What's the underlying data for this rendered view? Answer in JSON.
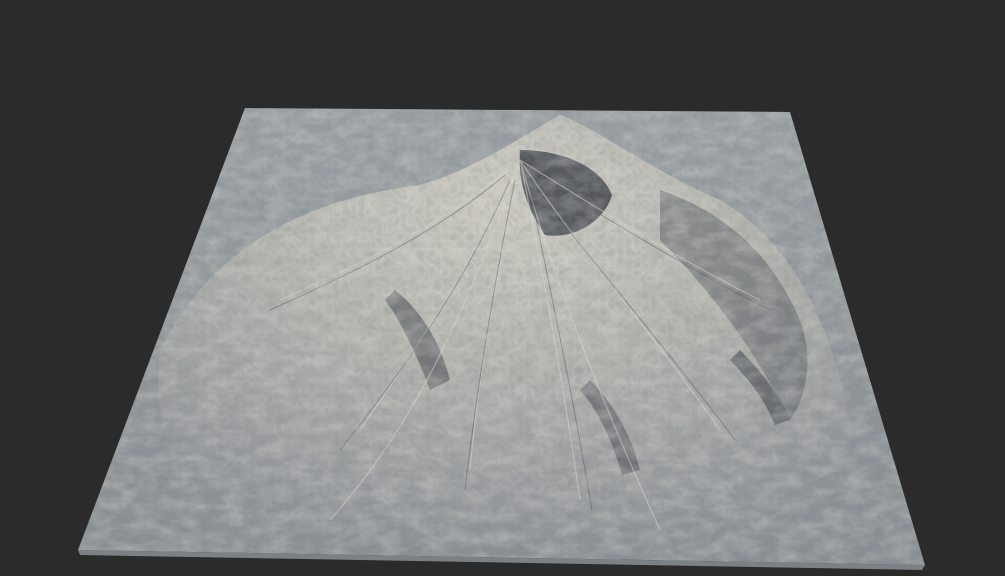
{
  "viewport": {
    "background_color": "#2b2b2b"
  },
  "terrain": {
    "kind": "volcano-heightmap-render",
    "base_color": "#8e9398",
    "highlight_color": "#c9c7bf",
    "shadow_color": "#3a3f45",
    "ground_color": "#a1a6aa"
  }
}
